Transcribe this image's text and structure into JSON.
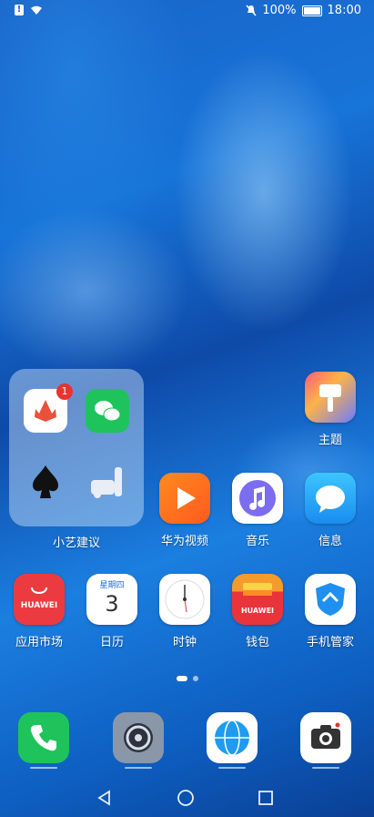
{
  "status": {
    "battery": "100%",
    "time": "18:00"
  },
  "folder": {
    "label": "小艺建议",
    "badge": "1"
  },
  "row1": [
    {
      "label": "主题"
    }
  ],
  "row2": [
    {
      "label": "华为视频"
    },
    {
      "label": "音乐"
    },
    {
      "label": "信息"
    }
  ],
  "row3": [
    {
      "label": "应用市场"
    },
    {
      "label": "日历"
    },
    {
      "label": "时钟"
    },
    {
      "label": "钱包"
    },
    {
      "label": "手机管家"
    }
  ],
  "calendar": {
    "weekday": "星期四",
    "day": "3"
  },
  "huawei_text": "HUAWEI",
  "wallpaper_colors": {
    "primary": "#1a64c8",
    "light": "#aad8ff"
  },
  "icons": [
    "phone-icon",
    "settings-icon",
    "browser-icon",
    "camera-icon"
  ]
}
